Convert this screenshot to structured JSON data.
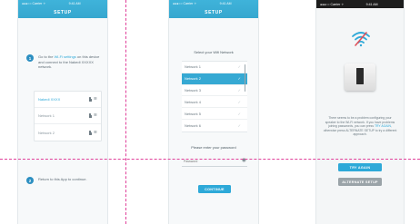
{
  "screen1": {
    "status_carrier": "●●●○○ Carrier ✧",
    "status_time": "9:41 AM",
    "title": "SETUP",
    "step1_number": "1",
    "step1_pre": "Go to the ",
    "step1_link": "Wi-Fi settings",
    "step1_post": " on this device and connect to the Nakedi XXXXX network.",
    "networks": [
      {
        "name": "Nakedi XXXX"
      },
      {
        "name": "Network 1"
      },
      {
        "name": "Network 2"
      }
    ],
    "step2_number": "2",
    "step2_text": "Return to this App to continue."
  },
  "screen2": {
    "status_carrier": "●●●○○ Carrier ✧",
    "status_time": "9:41 AM",
    "title": "SETUP",
    "select_label": "Select your Wifi Network",
    "networks": [
      {
        "name": "Network 1"
      },
      {
        "name": "Network 2"
      },
      {
        "name": "Network 3"
      },
      {
        "name": "Network 4"
      },
      {
        "name": "Network 5"
      },
      {
        "name": "Network 6"
      }
    ],
    "password_label": "Please enter your password",
    "password_placeholder": "Password",
    "continue_label": "CONTINUE"
  },
  "screen3": {
    "status_carrier": "●●●○○ Carrier ✧",
    "status_time": "9:41 AM",
    "message_pre": "There seems to be a problem configuring your speaker to the Wi-Fi network. If you have problems joining passwords, you can press ",
    "message_link": "TRY AGAIN",
    "message_post": ", otherwise press ALTERNATE SETUP to try a different approach.",
    "try_again_label": "TRY AGAIN",
    "alternate_label": "ALTERNATE SETUP"
  },
  "colors": {
    "accent": "#2ea9d8",
    "header": "#3fb3da",
    "selected_row": "#36a9d3",
    "guide": "#e0409a",
    "secondary_button": "#9aa3a8"
  },
  "icons": {
    "lock": "lock-icon",
    "wifi": "wifi-icon",
    "check": "check-icon",
    "eye": "eye-icon",
    "wifi_off": "wifi-off-icon",
    "device": "speaker-device-icon"
  }
}
